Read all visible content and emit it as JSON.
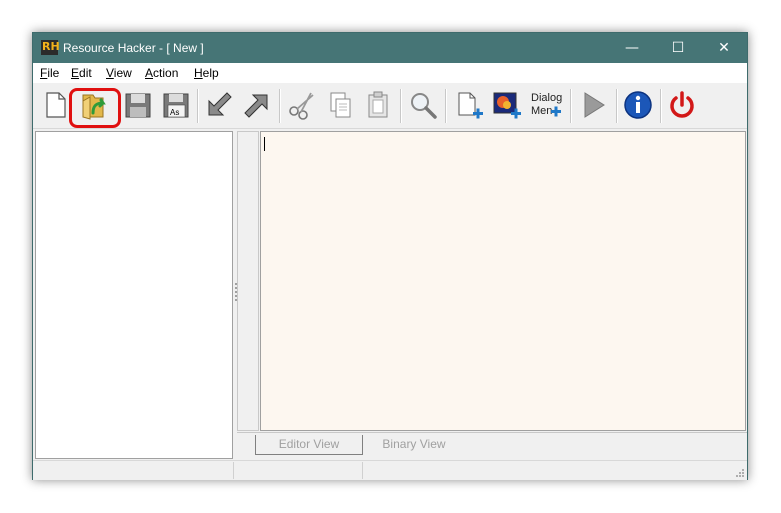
{
  "window": {
    "title": "Resource Hacker - [ New ]",
    "app_icon_text": "RH",
    "controls": {
      "minimize": "—",
      "maximize": "☐",
      "close": "✕"
    }
  },
  "menu": [
    {
      "label": "File",
      "underline": "F",
      "rest": "ile"
    },
    {
      "label": "Edit",
      "underline": "E",
      "rest": "dit"
    },
    {
      "label": "View",
      "underline": "V",
      "rest": "iew"
    },
    {
      "label": "Action",
      "underline": "A",
      "rest": "ction"
    },
    {
      "label": "Help",
      "underline": "H",
      "rest": "elp"
    }
  ],
  "toolbar": {
    "buttons": [
      {
        "name": "new-file",
        "icon": "new-document-icon"
      },
      {
        "name": "open-file",
        "icon": "open-folder-icon",
        "highlighted": true
      },
      {
        "name": "save",
        "icon": "floppy-disk-icon"
      },
      {
        "name": "save-as",
        "icon": "floppy-disk-as-icon"
      },
      {
        "name": "back",
        "icon": "arrow-down-left-icon"
      },
      {
        "name": "forward",
        "icon": "arrow-up-right-icon"
      },
      {
        "name": "cut",
        "icon": "scissors-icon"
      },
      {
        "name": "copy",
        "icon": "copy-icon"
      },
      {
        "name": "paste",
        "icon": "clipboard-icon"
      },
      {
        "name": "find",
        "icon": "magnifier-icon"
      },
      {
        "name": "add-blank-resource",
        "icon": "add-document-icon"
      },
      {
        "name": "add-image-resource",
        "icon": "add-image-icon"
      },
      {
        "name": "dialog-merger",
        "icon": "dialog-menu-icon"
      },
      {
        "name": "compile-script",
        "icon": "play-icon"
      },
      {
        "name": "about",
        "icon": "info-icon"
      },
      {
        "name": "exit",
        "icon": "power-icon"
      }
    ],
    "save_as_text": "As",
    "dialog_text_top": "Dialog",
    "dialog_text_bottom": "Men"
  },
  "tabs": {
    "editor": "Editor View",
    "binary": "Binary View"
  },
  "colors": {
    "titlebar": "#467576",
    "editor_bg": "#fdf7f0",
    "highlight": "#e01010"
  }
}
